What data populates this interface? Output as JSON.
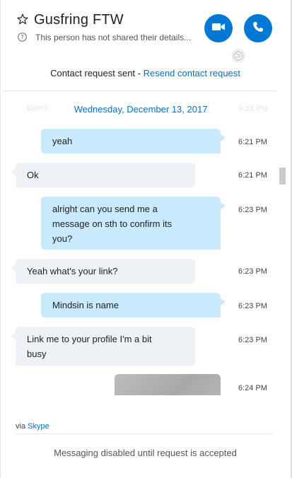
{
  "header": {
    "contact_name": "Gusfring FTW",
    "status_text": "This person has not shared their details...",
    "accent_color": "#0078d4"
  },
  "request": {
    "prefix": "Contact request sent - ",
    "link": "Resend contact request"
  },
  "chat": {
    "date_separator": "Wednesday, December 13, 2017",
    "messages": [
      {
        "direction": "out",
        "text": "yeah",
        "time": "6:21 PM"
      },
      {
        "direction": "in",
        "text": "Ok",
        "time": "6:21 PM"
      },
      {
        "direction": "out",
        "lines": [
          "alright can you send me a",
          "message on sth to confirm its",
          "you?"
        ],
        "time": "6:23 PM"
      },
      {
        "direction": "in",
        "text": "Yeah what's your link?",
        "time": "6:23 PM"
      },
      {
        "direction": "out",
        "text": "Mindsin is name",
        "time": "6:23 PM"
      },
      {
        "direction": "in",
        "lines": [
          "Link me to your profile I'm a bit",
          "busy"
        ],
        "time": "6:23 PM"
      },
      {
        "direction": "out",
        "type": "image",
        "time": "6:24 PM"
      }
    ]
  },
  "footer": {
    "via_prefix": "via ",
    "via_link": "Skype",
    "disabled_text": "Messaging disabled until request is accepted"
  }
}
